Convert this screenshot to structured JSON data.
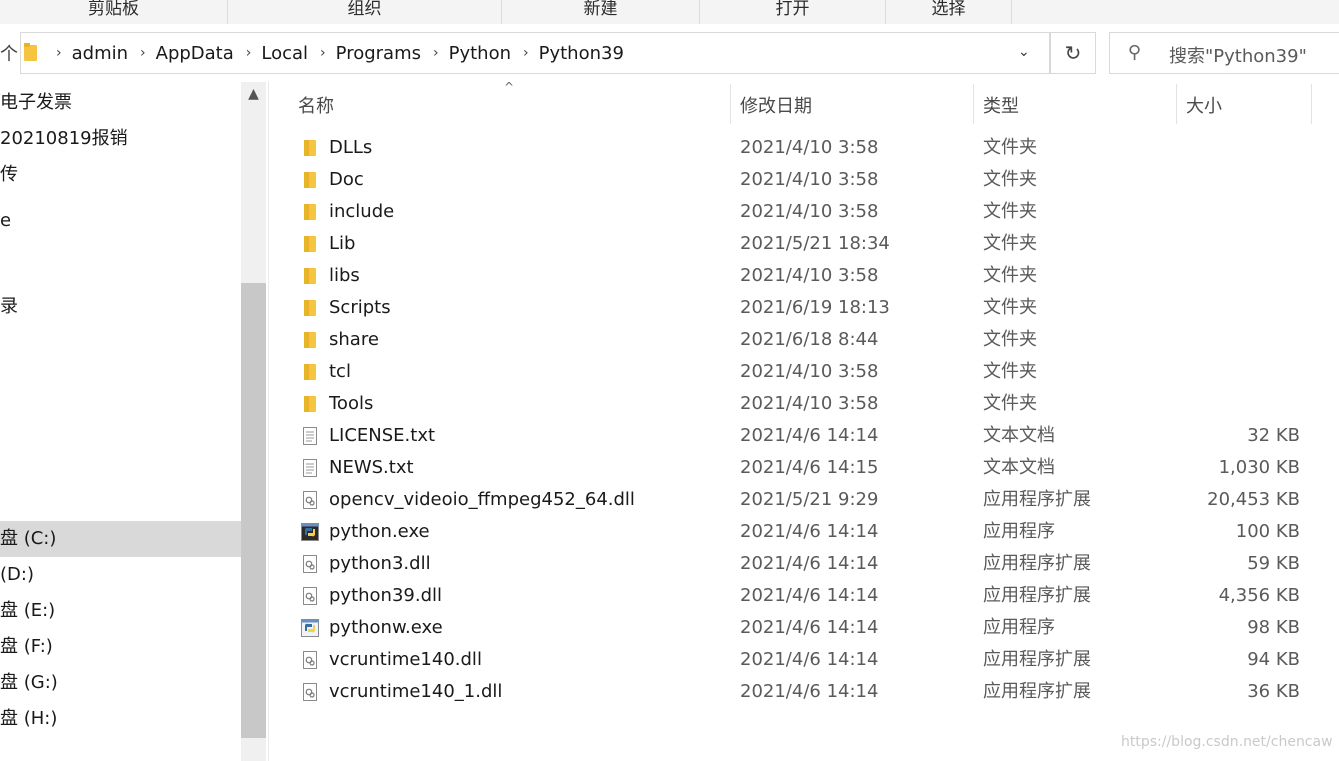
{
  "ribbon": {
    "groups": [
      "剪贴板",
      "组织",
      "新建",
      "打开",
      "选择"
    ]
  },
  "address": {
    "up_glyph": "个",
    "crumbs": [
      "admin",
      "AppData",
      "Local",
      "Programs",
      "Python",
      "Python39"
    ],
    "separator": "›",
    "dropdown_glyph": "⌄",
    "refresh_glyph": "↻"
  },
  "search": {
    "icon": "search-icon",
    "placeholder": "搜索\"Python39\""
  },
  "nav": {
    "items": [
      {
        "label": "电子发票",
        "selected": false
      },
      {
        "label": "20210819报销",
        "selected": false
      },
      {
        "label": "传",
        "selected": false
      },
      {
        "label": "e",
        "selected": false
      },
      {
        "label": "录",
        "selected": false
      },
      {
        "label": "盘 (C:)",
        "selected": true
      },
      {
        "label": "(D:)",
        "selected": false
      },
      {
        "label": "盘 (E:)",
        "selected": false
      },
      {
        "label": "盘 (F:)",
        "selected": false
      },
      {
        "label": "盘 (G:)",
        "selected": false
      },
      {
        "label": "盘 (H:)",
        "selected": false
      }
    ],
    "scroll_up_glyph": "▲"
  },
  "columns": {
    "name": "名称",
    "date": "修改日期",
    "type": "类型",
    "size": "大小",
    "sort_glyph": "^"
  },
  "files": [
    {
      "name": "DLLs",
      "date": "2021/4/10 3:58",
      "type": "文件夹",
      "size": "",
      "icon": "folder"
    },
    {
      "name": "Doc",
      "date": "2021/4/10 3:58",
      "type": "文件夹",
      "size": "",
      "icon": "folder"
    },
    {
      "name": "include",
      "date": "2021/4/10 3:58",
      "type": "文件夹",
      "size": "",
      "icon": "folder"
    },
    {
      "name": "Lib",
      "date": "2021/5/21 18:34",
      "type": "文件夹",
      "size": "",
      "icon": "folder"
    },
    {
      "name": "libs",
      "date": "2021/4/10 3:58",
      "type": "文件夹",
      "size": "",
      "icon": "folder"
    },
    {
      "name": "Scripts",
      "date": "2021/6/19 18:13",
      "type": "文件夹",
      "size": "",
      "icon": "folder"
    },
    {
      "name": "share",
      "date": "2021/6/18 8:44",
      "type": "文件夹",
      "size": "",
      "icon": "folder"
    },
    {
      "name": "tcl",
      "date": "2021/4/10 3:58",
      "type": "文件夹",
      "size": "",
      "icon": "folder"
    },
    {
      "name": "Tools",
      "date": "2021/4/10 3:58",
      "type": "文件夹",
      "size": "",
      "icon": "folder"
    },
    {
      "name": "LICENSE.txt",
      "date": "2021/4/6 14:14",
      "type": "文本文档",
      "size": "32 KB",
      "icon": "text"
    },
    {
      "name": "NEWS.txt",
      "date": "2021/4/6 14:15",
      "type": "文本文档",
      "size": "1,030 KB",
      "icon": "text"
    },
    {
      "name": "opencv_videoio_ffmpeg452_64.dll",
      "date": "2021/5/21 9:29",
      "type": "应用程序扩展",
      "size": "20,453 KB",
      "icon": "dll"
    },
    {
      "name": "python.exe",
      "date": "2021/4/6 14:14",
      "type": "应用程序",
      "size": "100 KB",
      "icon": "python"
    },
    {
      "name": "python3.dll",
      "date": "2021/4/6 14:14",
      "type": "应用程序扩展",
      "size": "59 KB",
      "icon": "dll"
    },
    {
      "name": "python39.dll",
      "date": "2021/4/6 14:14",
      "type": "应用程序扩展",
      "size": "4,356 KB",
      "icon": "dll"
    },
    {
      "name": "pythonw.exe",
      "date": "2021/4/6 14:14",
      "type": "应用程序",
      "size": "98 KB",
      "icon": "pythonw"
    },
    {
      "name": "vcruntime140.dll",
      "date": "2021/4/6 14:14",
      "type": "应用程序扩展",
      "size": "94 KB",
      "icon": "dll"
    },
    {
      "name": "vcruntime140_1.dll",
      "date": "2021/4/6 14:14",
      "type": "应用程序扩展",
      "size": "36 KB",
      "icon": "dll"
    }
  ],
  "watermark": "https://blog.csdn.net/chencaw",
  "colors": {
    "folder": "#f5c542",
    "selected_bg": "#d9d9d9",
    "python_blue": "#3670a0",
    "python_yellow": "#f7d04a"
  }
}
